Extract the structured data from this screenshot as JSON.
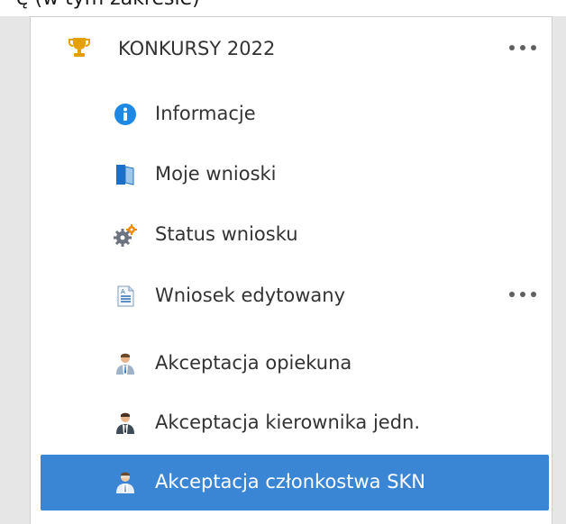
{
  "top_partial_text": "ę (w tym zakresie)",
  "menu": {
    "section": {
      "title": "KONKURSY 2022",
      "icon": "trophy-icon",
      "more_icon": "more-dots-icon"
    },
    "items": [
      {
        "label": "Informacje",
        "icon": "info-icon"
      },
      {
        "label": "Moje wnioski",
        "icon": "document-folder-icon"
      },
      {
        "label": "Status wniosku",
        "icon": "gears-icon"
      },
      {
        "label": "Wniosek edytowany",
        "icon": "edited-document-icon",
        "more_icon": "more-dots-icon"
      },
      {
        "label": "Akceptacja opiekuna",
        "icon": "user-tie-icon"
      },
      {
        "label": "Akceptacja kierownika jedn.",
        "icon": "manager-icon"
      },
      {
        "label": "Akceptacja członkostwa SKN",
        "icon": "member-icon",
        "active": true
      }
    ]
  },
  "colors": {
    "active_bg": "#3b86d4",
    "active_text": "#ffffff",
    "text": "#333333",
    "frame_bg": "#e6e6e6",
    "trophy": "#e3a000",
    "info": "#1e88e5"
  }
}
